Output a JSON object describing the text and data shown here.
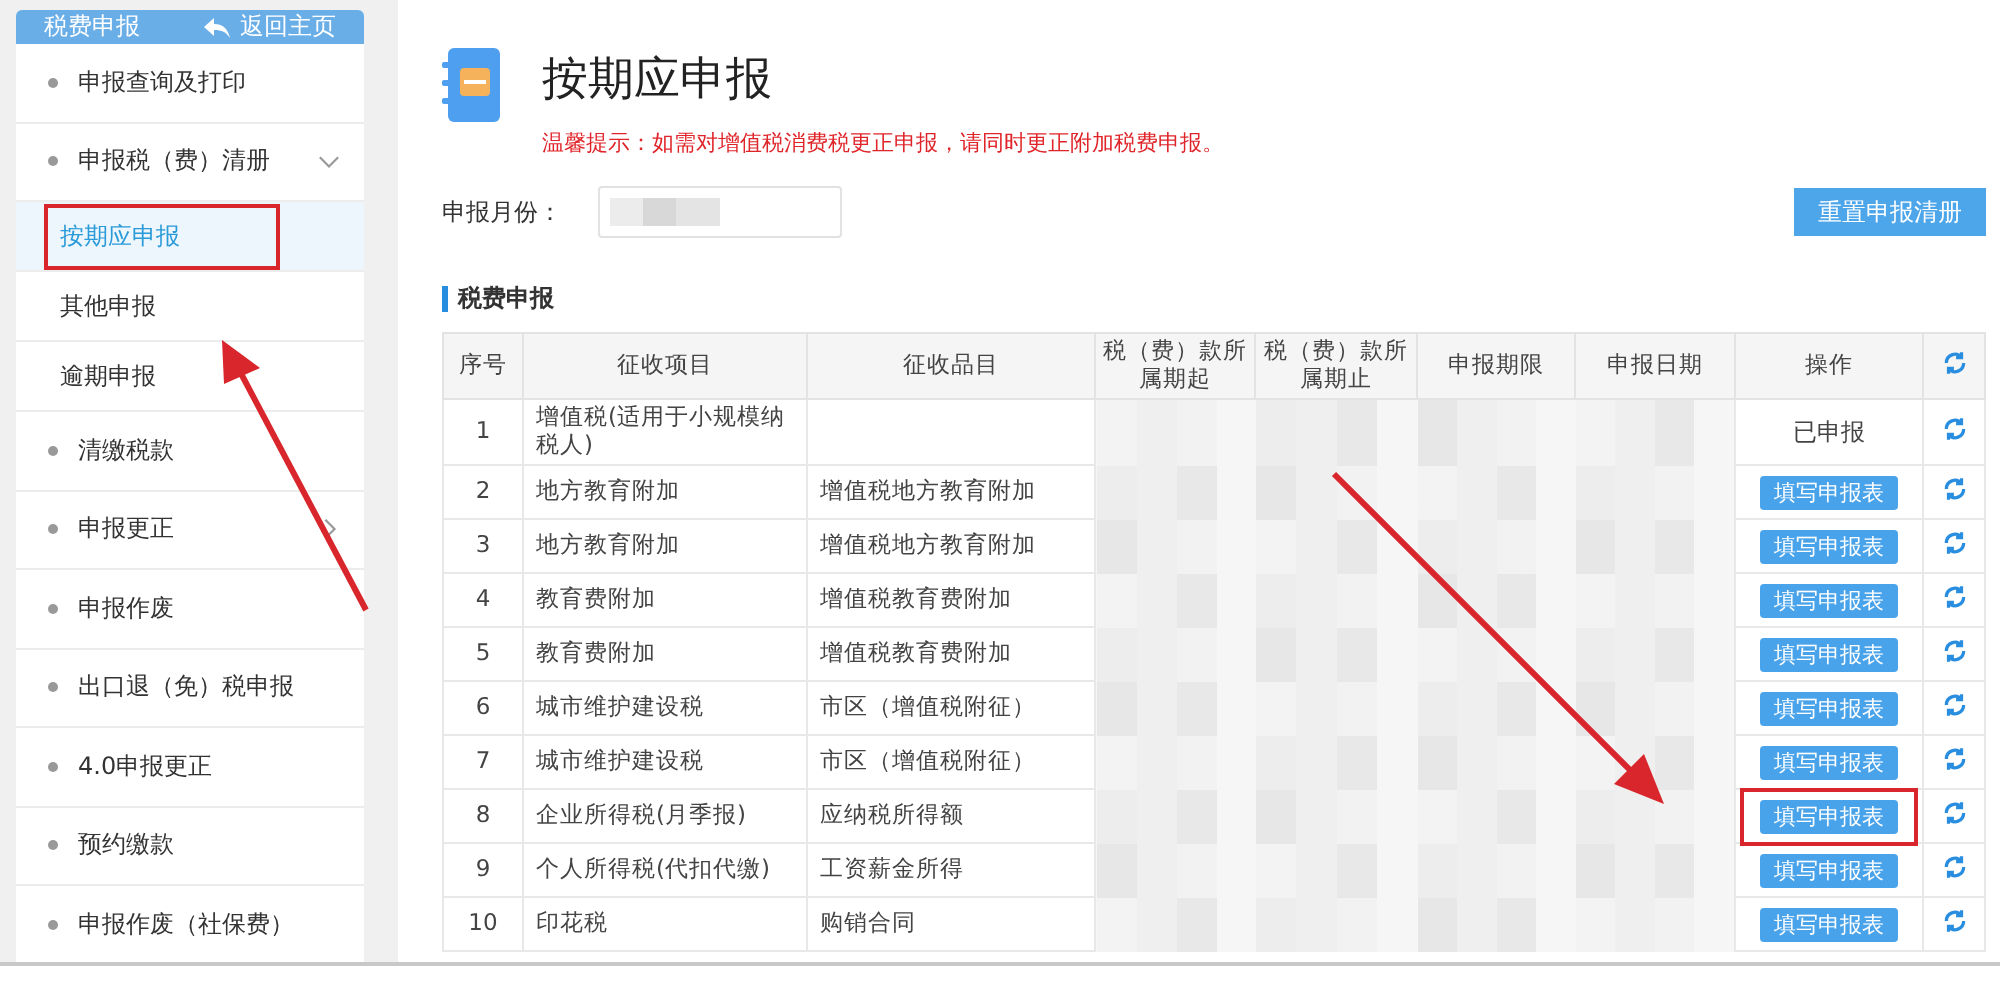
{
  "sidebar": {
    "title": "税费申报",
    "back_link": "返回主页",
    "items": [
      {
        "kind": "link",
        "label": "申报查询及打印"
      },
      {
        "kind": "group",
        "label": "申报税（费）清册",
        "expanded": true,
        "children": [
          {
            "label": "按期应申报",
            "selected": true,
            "highlighted": true
          },
          {
            "label": "其他申报",
            "selected": false,
            "highlighted": false
          },
          {
            "label": "逾期申报",
            "selected": false,
            "highlighted": false
          }
        ]
      },
      {
        "kind": "link",
        "label": "清缴税款"
      },
      {
        "kind": "group",
        "label": "申报更正",
        "expanded": false
      },
      {
        "kind": "link",
        "label": "申报作废"
      },
      {
        "kind": "link",
        "label": "出口退（免）税申报"
      },
      {
        "kind": "link",
        "label": "4.0申报更正"
      },
      {
        "kind": "link",
        "label": "预约缴款"
      },
      {
        "kind": "link",
        "label": "申报作废（社保费）"
      }
    ]
  },
  "page": {
    "title": "按期应申报",
    "notice": "温馨提示：如需对增值税消费税更正申报，请同时更正附加税费申报。",
    "month_label": "申报月份：",
    "reset_button": "重置申报清册"
  },
  "section_title": "税费申报",
  "table": {
    "columns": [
      "序号",
      "征收项目",
      "征收品目",
      "税（费）款所属期起",
      "税（费）款所属期止",
      "申报期限",
      "申报日期",
      "操作"
    ],
    "rows": [
      {
        "no": "1",
        "item": "增值税(适用于小规模纳税人)",
        "category": "",
        "kind": "status",
        "action": "已申报",
        "highlighted": false
      },
      {
        "no": "2",
        "item": "地方教育附加",
        "category": "增值税地方教育附加",
        "kind": "button",
        "action": "填写申报表",
        "highlighted": false
      },
      {
        "no": "3",
        "item": "地方教育附加",
        "category": "增值税地方教育附加",
        "kind": "button",
        "action": "填写申报表",
        "highlighted": false
      },
      {
        "no": "4",
        "item": "教育费附加",
        "category": "增值税教育费附加",
        "kind": "button",
        "action": "填写申报表",
        "highlighted": false
      },
      {
        "no": "5",
        "item": "教育费附加",
        "category": "增值税教育费附加",
        "kind": "button",
        "action": "填写申报表",
        "highlighted": false
      },
      {
        "no": "6",
        "item": "城市维护建设税",
        "category": "市区（增值税附征）",
        "kind": "button",
        "action": "填写申报表",
        "highlighted": false
      },
      {
        "no": "7",
        "item": "城市维护建设税",
        "category": "市区（增值税附征）",
        "kind": "button",
        "action": "填写申报表",
        "highlighted": false
      },
      {
        "no": "8",
        "item": "企业所得税(月季报)",
        "category": "应纳税所得额",
        "kind": "button",
        "action": "填写申报表",
        "highlighted": true
      },
      {
        "no": "9",
        "item": "个人所得税(代扣代缴)",
        "category": "工资薪金所得",
        "kind": "button",
        "action": "填写申报表",
        "highlighted": false
      },
      {
        "no": "10",
        "item": "印花税",
        "category": "购销合同",
        "kind": "button",
        "action": "填写申报表",
        "highlighted": false
      }
    ]
  }
}
